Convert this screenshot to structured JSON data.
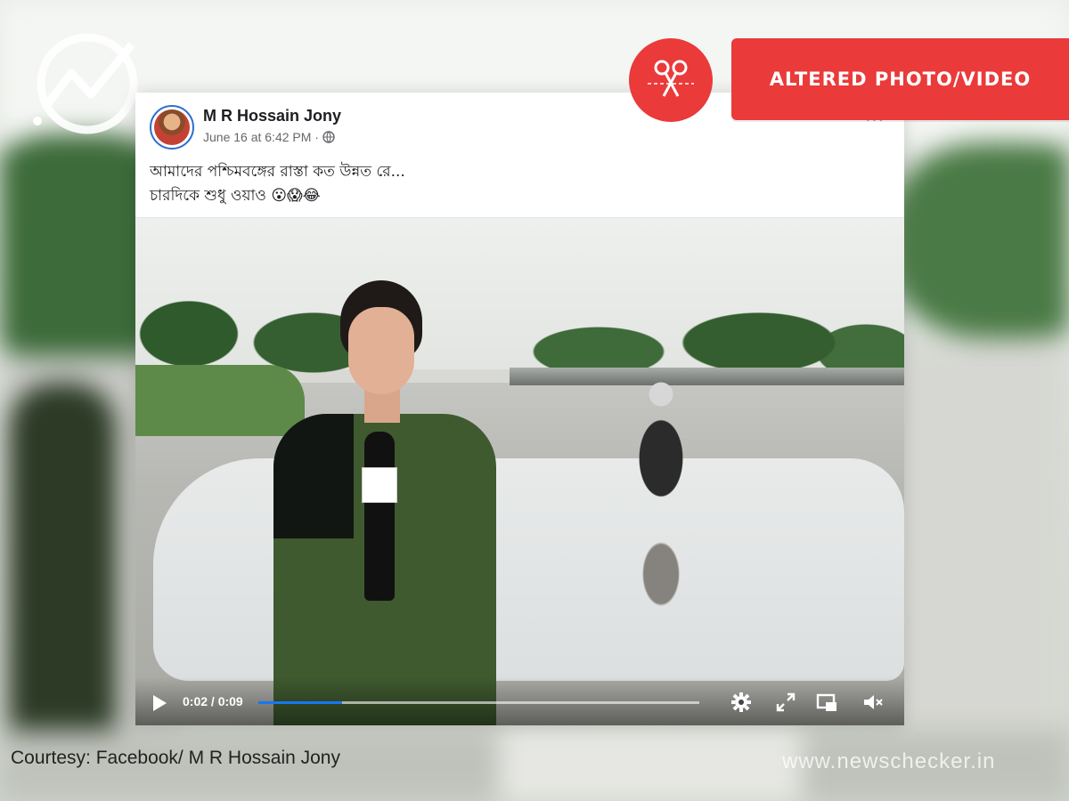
{
  "post": {
    "author": "M R Hossain Jony",
    "date": "June 16 at 6:42 PM",
    "separator": "·",
    "text_line1": "আমাদের পশ্চিমবঙ্গের রাস্তা কত উন্নত রে...",
    "text_line2": "চারদিকে শুধু ওয়াও 😮😱😂"
  },
  "video": {
    "time": "0:02 / 0:09",
    "progress": 0.19
  },
  "badge": {
    "label": "ALTERED PHOTO/VIDEO",
    "color": "#ea3a3a"
  },
  "footer": {
    "courtesy": "Courtesy: Facebook/ M R Hossain Jony",
    "site": "www.newschecker.in"
  },
  "icons": [
    "newschecker-logo-icon",
    "globe-icon",
    "more-icon",
    "play-icon",
    "gear-icon",
    "fullscreen-icon",
    "pip-icon",
    "volume-muted-icon",
    "scissors-icon"
  ],
  "colors": {
    "facebook_blue": "#1877f2",
    "alert_red": "#ea3a3a"
  }
}
